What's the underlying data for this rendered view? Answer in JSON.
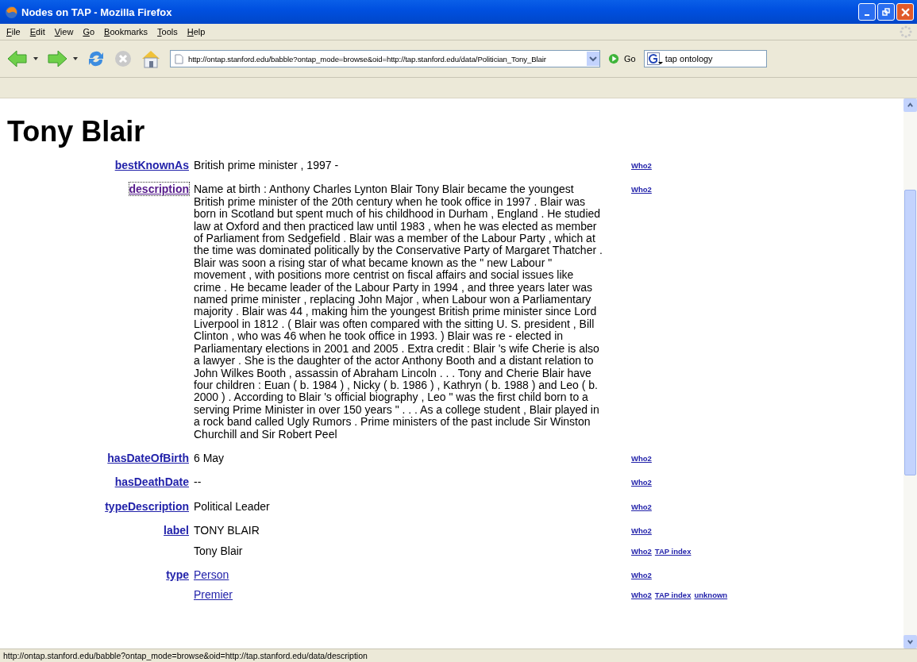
{
  "window": {
    "title": "Nodes on TAP - Mozilla Firefox"
  },
  "menu": [
    {
      "label": "File"
    },
    {
      "label": "Edit"
    },
    {
      "label": "View"
    },
    {
      "label": "Go"
    },
    {
      "label": "Bookmarks"
    },
    {
      "label": "Tools"
    },
    {
      "label": "Help"
    }
  ],
  "toolbar": {
    "address": "http://ontap.stanford.edu/babble?ontap_mode=browse&oid=http://tap.stanford.edu/data/Politician_Tony_Blair",
    "go_label": "Go",
    "search": "tap ontology",
    "stop_disabled": true
  },
  "page": {
    "heading": "Tony Blair",
    "properties": [
      {
        "name": "bestKnownAs",
        "focused": false,
        "values": [
          {
            "text": "British prime minister , 1997 -",
            "link": false,
            "sources": [
              "Who2"
            ]
          }
        ]
      },
      {
        "name": "description",
        "focused": true,
        "values": [
          {
            "text": "Name at birth : Anthony Charles Lynton Blair Tony Blair became the youngest British prime minister of the 20th century when he took office in 1997 . Blair was born in Scotland but spent much of his childhood in Durham , England . He studied law at Oxford and then practiced law until 1983 , when he was elected as member of Parliament from Sedgefield . Blair was a member of the Labour Party , which at the time was dominated politically by the Conservative Party of Margaret Thatcher . Blair was soon a rising star of what became known as the \" new Labour \" movement , with positions more centrist on fiscal affairs and social issues like crime . He became leader of the Labour Party in 1994 , and three years later was named prime minister , replacing John Major , when Labour won a Parliamentary majority . Blair was 44 , making him the youngest British prime minister since Lord Liverpool in 1812 . ( Blair was often compared with the sitting U. S. president , Bill Clinton , who was 46 when he took office in 1993. ) Blair was re - elected in Parliamentary elections in 2001 and 2005 . Extra credit : Blair 's wife Cherie is also a lawyer . She is the daughter of the actor Anthony Booth and a distant relation to John Wilkes Booth , assassin of Abraham Lincoln . . . Tony and Cherie Blair have four children : Euan ( b. 1984 ) , Nicky ( b. 1986 ) , Kathryn ( b. 1988 ) and Leo ( b. 2000 ) . According to Blair 's official biography , Leo \" was the first child born to a serving Prime Minister in over 150 years \" . . . As a college student , Blair played in a rock band called Ugly Rumors . Prime ministers of the past include Sir Winston Churchill and Sir Robert Peel",
            "link": false,
            "sources": [
              "Who2"
            ]
          }
        ]
      },
      {
        "name": "hasDateOfBirth",
        "focused": false,
        "values": [
          {
            "text": "6 May",
            "link": false,
            "sources": [
              "Who2"
            ]
          }
        ]
      },
      {
        "name": "hasDeathDate",
        "focused": false,
        "values": [
          {
            "text": "--",
            "link": false,
            "sources": [
              "Who2"
            ]
          }
        ]
      },
      {
        "name": "typeDescription",
        "focused": false,
        "values": [
          {
            "text": "Political Leader",
            "link": false,
            "sources": [
              "Who2"
            ]
          }
        ]
      },
      {
        "name": "label",
        "focused": false,
        "values": [
          {
            "text": "TONY BLAIR",
            "link": false,
            "sources": [
              "Who2"
            ]
          },
          {
            "text": "Tony Blair",
            "link": false,
            "sources": [
              "Who2",
              "TAP index"
            ]
          }
        ]
      },
      {
        "name": "type",
        "focused": false,
        "values": [
          {
            "text": "Person",
            "link": true,
            "sources": [
              "Who2"
            ]
          },
          {
            "text": "Premier",
            "link": true,
            "sources": [
              "Who2",
              "TAP index",
              "unknown"
            ]
          }
        ]
      }
    ]
  },
  "status_bar": "http://ontap.stanford.edu/babble?ontap_mode=browse&oid=http://tap.stanford.edu/data/description"
}
